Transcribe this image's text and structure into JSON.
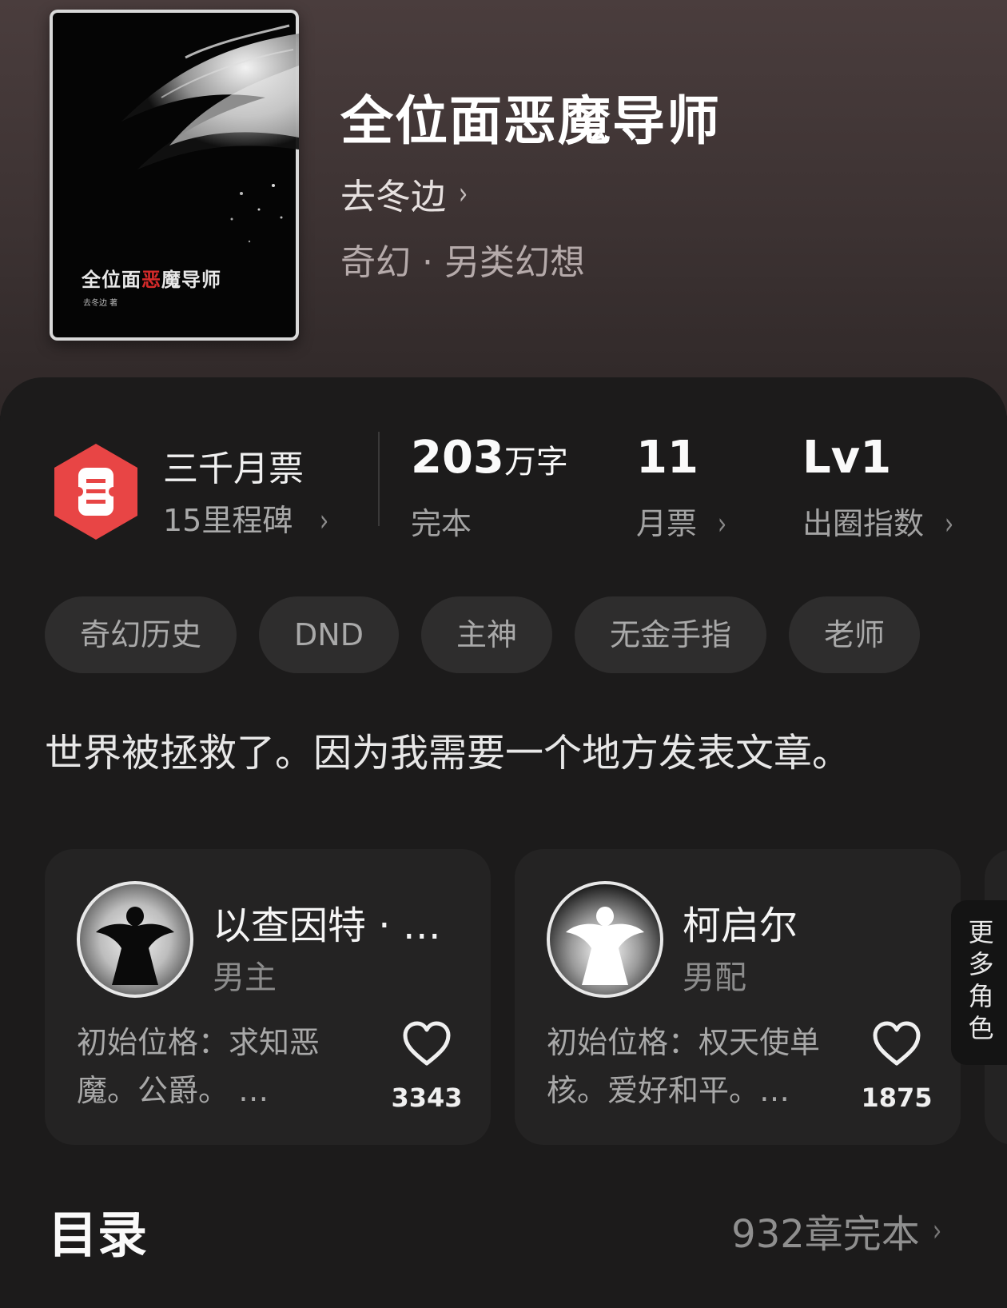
{
  "book": {
    "title": "全位面恶魔导师",
    "author": "去冬边",
    "genre": "奇幻 · 另类幻想",
    "cover_title_pre": "全位面",
    "cover_title_red": "恶",
    "cover_title_post": "魔导师",
    "cover_author": "去冬边 著"
  },
  "stats": {
    "ticket_title": "三千月票",
    "ticket_sub": "15里程碑",
    "words_num": "203",
    "words_unit": "万字",
    "words_label": "完本",
    "monthly_num": "11",
    "monthly_label": "月票",
    "index_num": "Lv1",
    "index_label": "出圈指数"
  },
  "tags": [
    "奇幻历史",
    "DND",
    "主神",
    "无金手指",
    "老师"
  ],
  "intro": "世界被拯救了。因为我需要一个地方发表文章。",
  "characters": [
    {
      "name": "以查因特 · …",
      "role": "男主",
      "desc": "初始位格：求知恶魔。公爵。 …",
      "likes": "3343"
    },
    {
      "name": "柯启尔",
      "role": "男配",
      "desc": "初始位格：权天使单核。爱好和平。…",
      "likes": "1875"
    }
  ],
  "more_roles": "更多角色",
  "toc": {
    "title": "目录",
    "info": "932章完本"
  },
  "colors": {
    "accent_red": "#e84545",
    "panel_bg": "#1c1b1b",
    "hero_bg": "#3c3232"
  }
}
